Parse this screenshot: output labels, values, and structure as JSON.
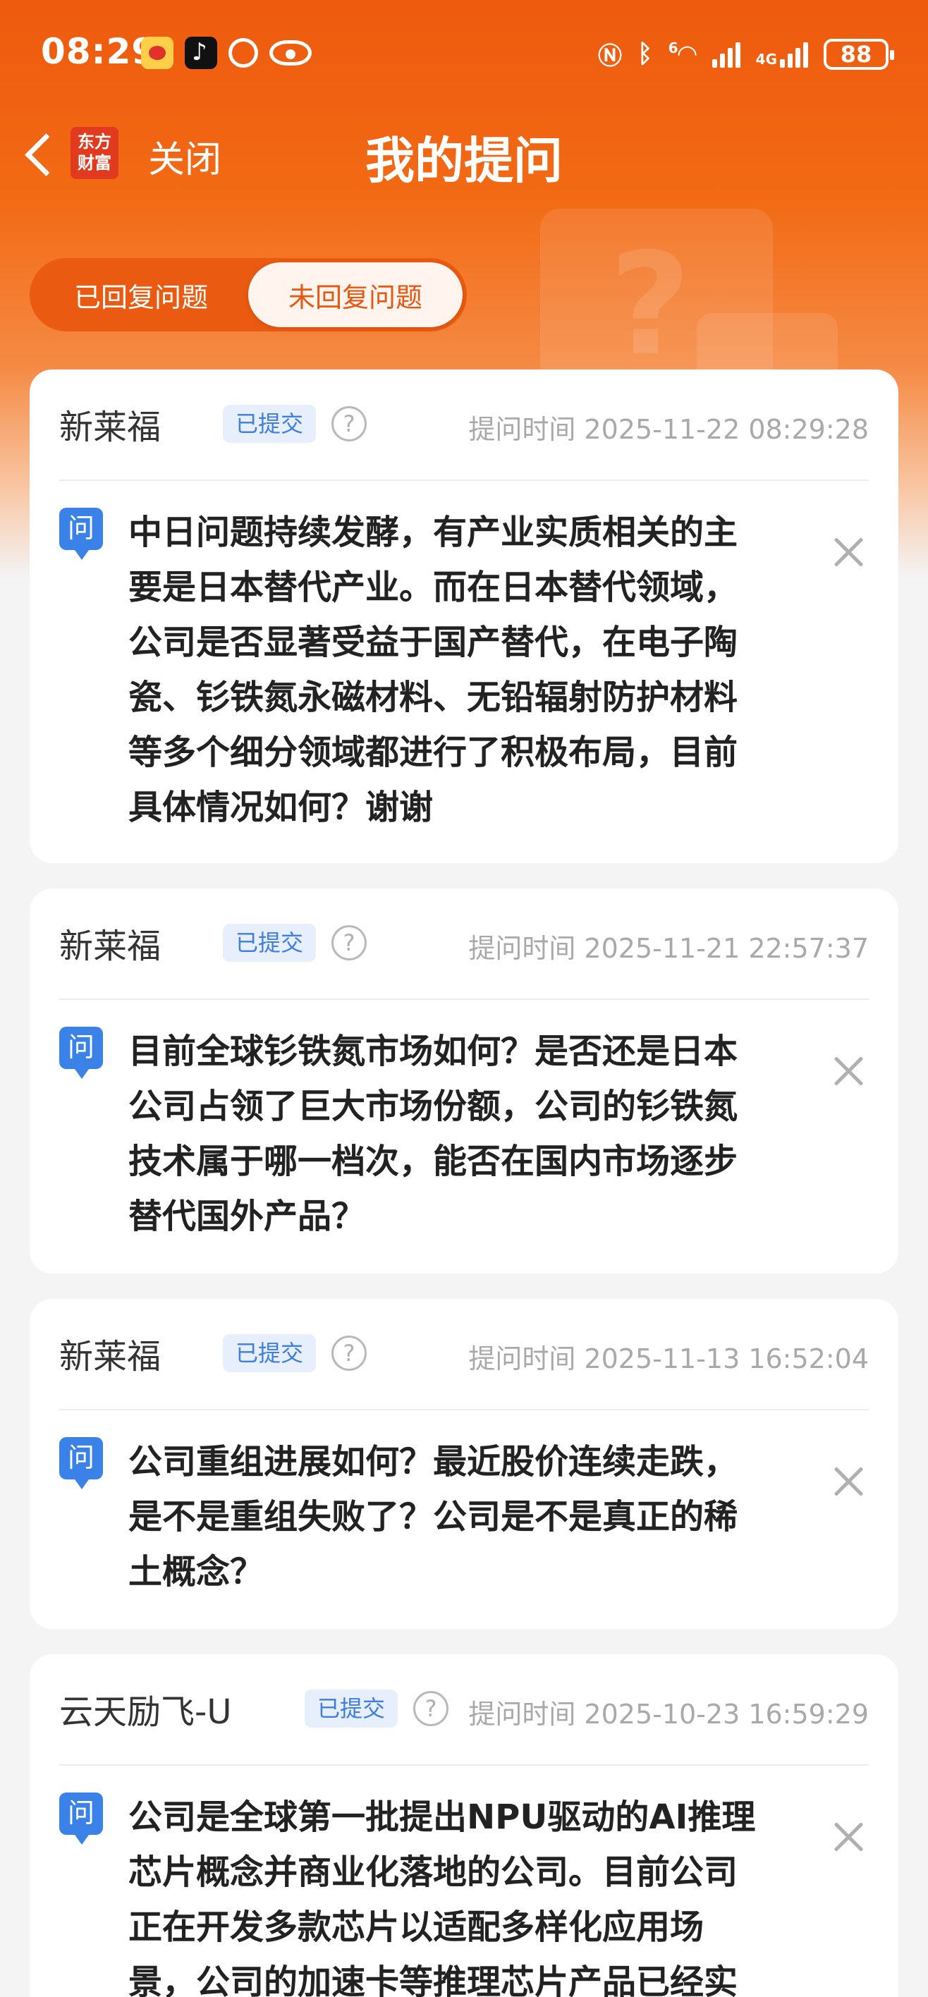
{
  "status_bar": {
    "time": "08:29",
    "network": "4G",
    "wifi_badge": "6",
    "battery": "88",
    "left_icons": [
      "weibo-icon",
      "tiktok-icon",
      "app-circle-icon",
      "eye-icon"
    ],
    "right_icons": [
      "nfc-icon",
      "bluetooth-icon",
      "wifi-icon",
      "signal-icon",
      "signal-4g-icon",
      "battery-icon"
    ]
  },
  "nav": {
    "logo_line1": "东方",
    "logo_line2": "财富",
    "close_label": "关闭",
    "title": "我的提问"
  },
  "tabs": [
    {
      "label": "已回复问题",
      "active": false
    },
    {
      "label": "未回复问题",
      "active": true
    }
  ],
  "questions": [
    {
      "asker": "新莱福",
      "status": "已提交",
      "time": "提问时间 2025-11-22 08:29:28",
      "text": [
        "中日问题持续发酵，有产业实质相关的主",
        "要是日本替代产业。而在日本替代领域，",
        "公司是否显著受益于国产替代，在电子陶",
        "瓷、钐铁氮永磁材料、无铅辐射防护材料",
        "等多个细分领域都进行了积极布局，目前",
        "具体情况如何？谢谢"
      ]
    },
    {
      "asker": "新莱福",
      "status": "已提交",
      "time": "提问时间 2025-11-21 22:57:37",
      "text": [
        "目前全球钐铁氮市场如何？是否还是日本",
        "公司占领了巨大市场份额，公司的钐铁氮",
        "技术属于哪一档次，能否在国内市场逐步",
        "替代国外产品？"
      ]
    },
    {
      "asker": "新莱福",
      "status": "已提交",
      "time": "提问时间 2025-11-13 16:52:04",
      "text": [
        "公司重组进展如何？最近股价连续走跌，",
        "是不是重组失败了？公司是不是真正的稀",
        "土概念？"
      ]
    },
    {
      "asker": "云天励飞-U",
      "status": "已提交",
      "time": "提问时间 2025-10-23 16:59:29",
      "text": [
        "公司是全球第一批提出NPU驱动的AI推理",
        "芯片概念并商业化落地的公司。目前公司",
        "正在开发多款芯片以适配多样化应用场",
        "景，公司的加速卡等推理芯片产品已经实"
      ]
    }
  ],
  "labels": {
    "question_icon": "问",
    "help_icon": "?"
  },
  "colors": {
    "brand_orange": "#ee5a0e",
    "badge_blue": "#3f7de0",
    "question_blue": "#3b82e8"
  }
}
